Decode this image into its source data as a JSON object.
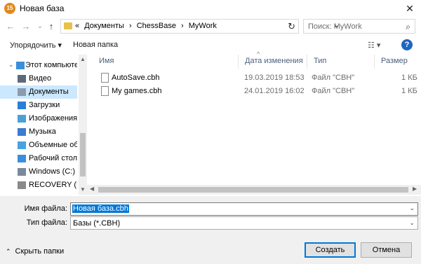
{
  "window": {
    "title": "Новая база",
    "app_icon": "15",
    "close_glyph": "✕"
  },
  "nav": {
    "back_glyph": "←",
    "forward_glyph": "→",
    "recent_glyph": "⌄",
    "up_glyph": "↑",
    "breadcrumbs": [
      "«",
      "Документы",
      "›",
      "ChessBase",
      "›",
      "MyWork"
    ],
    "dropdown_glyph": "⌄",
    "refresh_glyph": "↻",
    "search_placeholder": "Поиск: MyWork",
    "search_glyph": "⌕"
  },
  "toolbar": {
    "organize_label": "Упорядочить ▾",
    "new_folder_label": "Новая папка",
    "view_glyph": "☷ ▾",
    "help_glyph": "?"
  },
  "sidebar": {
    "items": [
      {
        "label": "Этот компьютер",
        "icon": "computer-icon",
        "color": "#3b8ed8",
        "selected": false
      },
      {
        "label": "Видео",
        "icon": "video-icon",
        "color": "#5c6a7a",
        "selected": false
      },
      {
        "label": "Документы",
        "icon": "documents-icon",
        "color": "#8a9bb0",
        "selected": true
      },
      {
        "label": "Загрузки",
        "icon": "downloads-icon",
        "color": "#2a7fd4",
        "selected": false
      },
      {
        "label": "Изображения",
        "icon": "images-icon",
        "color": "#4aa0d6",
        "selected": false
      },
      {
        "label": "Музыка",
        "icon": "music-icon",
        "color": "#3b7bd0",
        "selected": false
      },
      {
        "label": "Объемные объ",
        "icon": "3d-objects-icon",
        "color": "#47a3e0",
        "selected": false
      },
      {
        "label": "Рабочий стол",
        "icon": "desktop-icon",
        "color": "#3c8fdc",
        "selected": false
      },
      {
        "label": "Windows (C:)",
        "icon": "drive-icon",
        "color": "#7a8a9a",
        "selected": false
      },
      {
        "label": "RECOVERY (D:)",
        "icon": "drive-icon",
        "color": "#8a8a8a",
        "selected": false
      }
    ]
  },
  "filelist": {
    "columns": [
      "Имя",
      "Дата изменения",
      "Тип",
      "Размер"
    ],
    "rows": [
      {
        "name": "AutoSave.cbh",
        "date": "19.03.2019 18:53",
        "type": "Файл \"CBH\"",
        "size": "1 КБ"
      },
      {
        "name": "My games.cbh",
        "date": "24.01.2019 16:02",
        "type": "Файл \"CBH\"",
        "size": "1 КБ"
      }
    ]
  },
  "form": {
    "filename_label": "Имя файла:",
    "filename_value": "Новая база.cbh",
    "filetype_label": "Тип файла:",
    "filetype_value": "Базы (*.CBH)"
  },
  "footer": {
    "hide_folders_label": "Скрыть папки",
    "create_label": "Создать",
    "cancel_label": "Отмена"
  },
  "colors": {
    "accent": "#0078d7",
    "selection": "#cce8ff",
    "help": "#1f66c4"
  }
}
